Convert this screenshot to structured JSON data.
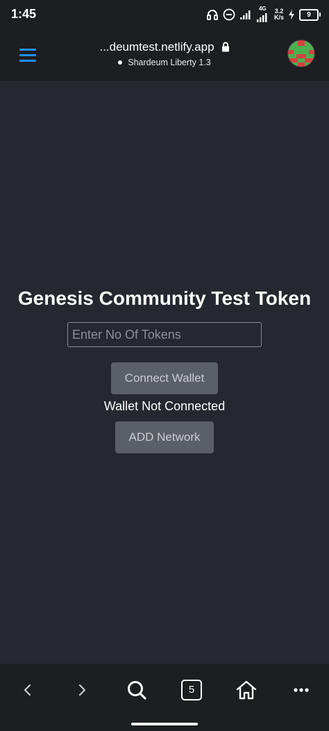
{
  "status_bar": {
    "time": "1:45",
    "network_type": "4G",
    "speed_value": "3.2",
    "speed_unit": "K/s",
    "battery_level": "9",
    "icons": [
      "headphones-icon",
      "do-not-disturb-icon",
      "signal-icon",
      "signal-4g-icon",
      "charging-icon",
      "battery-icon"
    ]
  },
  "header": {
    "url": "...deumtest.netlify.app",
    "network_name": "Shardeum Liberty 1.3",
    "accent_color": "#1e90ff"
  },
  "main": {
    "title": "Genesis Community Test Token",
    "token_input": {
      "value": "",
      "placeholder": "Enter No Of Tokens"
    },
    "connect_wallet_label": "Connect Wallet",
    "wallet_status": "Wallet Not Connected",
    "add_network_label": "ADD Network"
  },
  "bottom_nav": {
    "tab_count": "5",
    "icons": [
      "back-arrow-icon",
      "forward-arrow-icon",
      "search-icon",
      "tabs-icon",
      "home-icon",
      "more-icon"
    ]
  }
}
